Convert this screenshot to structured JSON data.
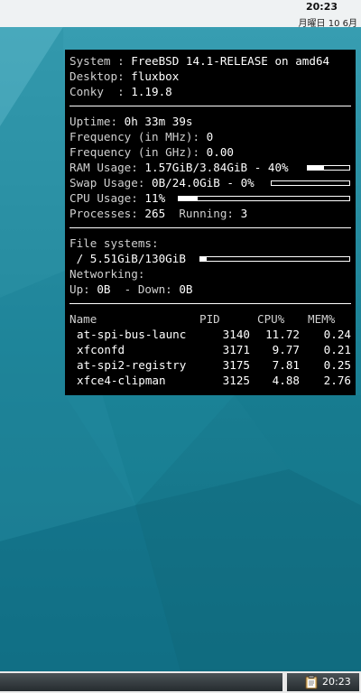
{
  "top_clock": {
    "time": "20:23",
    "date": "月曜日 10 6月"
  },
  "conky": {
    "system_label": "System : ",
    "system_value": "FreeBSD 14.1-RELEASE on amd64",
    "desktop_label": "Desktop: ",
    "desktop_value": "fluxbox",
    "conky_label": "Conky  : ",
    "conky_value": "1.19.8",
    "uptime_label": "Uptime: ",
    "uptime_value": "0h 33m 39s",
    "freq_mhz_label": "Frequency (in MHz): ",
    "freq_mhz_value": "0",
    "freq_ghz_label": "Frequency (in GHz): ",
    "freq_ghz_value": "0.00",
    "ram_label": "RAM Usage: ",
    "ram_value": "1.57GiB/3.84GiB - 40%",
    "ram_fraction": 0.4,
    "swap_label": "Swap Usage: ",
    "swap_value": "0B/24.0GiB - 0%",
    "swap_fraction": 0.0,
    "cpu_label": "CPU Usage: ",
    "cpu_value": "11%",
    "cpu_fraction": 0.11,
    "processes_label": "Processes: ",
    "processes_value": "265",
    "running_label": "  Running: ",
    "running_value": "3",
    "fs_heading": "File systems:",
    "fs_root_prefix": " / ",
    "fs_root_value": "5.51GiB/130GiB",
    "fs_fraction": 0.04,
    "net_heading": "Networking:",
    "up_label": "Up: ",
    "up_value": "0B",
    "down_label": "  - Down: ",
    "down_value": "0B",
    "process_headers": {
      "name": "Name",
      "pid": "PID",
      "cpu": "CPU%",
      "mem": "MEM%"
    },
    "processes": [
      {
        "name": "at-spi-bus-launc",
        "pid": "3140",
        "cpu": "11.72",
        "mem": "0.24"
      },
      {
        "name": "xfconfd",
        "pid": "3171",
        "cpu": "9.77",
        "mem": "0.21"
      },
      {
        "name": "at-spi2-registry",
        "pid": "3175",
        "cpu": "7.81",
        "mem": "0.25"
      },
      {
        "name": "xfce4-clipman",
        "pid": "3125",
        "cpu": "4.88",
        "mem": "2.76"
      }
    ]
  },
  "taskbar": {
    "tray_clock": "20:23",
    "tray_icon": "clipboard-icon"
  }
}
